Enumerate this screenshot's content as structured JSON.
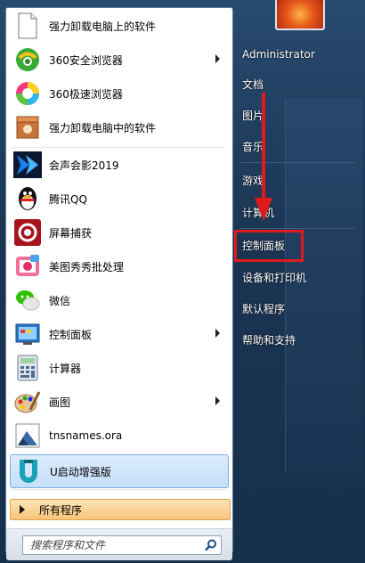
{
  "left_items": [
    {
      "label": "强力卸载电脑上的软件",
      "icon": "document-icon",
      "arrow": false
    },
    {
      "label": "360安全浏览器",
      "icon": "browser-360-icon",
      "arrow": true
    },
    {
      "label": "360极速浏览器",
      "icon": "browser-360-speed-icon",
      "arrow": false
    },
    {
      "label": "强力卸载电脑中的软件",
      "icon": "uninstall-box-icon",
      "arrow": false
    },
    {
      "label": "会声会影2019",
      "icon": "video-editor-icon",
      "arrow": false
    },
    {
      "label": "腾讯QQ",
      "icon": "qq-penguin-icon",
      "arrow": false
    },
    {
      "label": "屏幕捕获",
      "icon": "screen-capture-icon",
      "arrow": false
    },
    {
      "label": "美图秀秀批处理",
      "icon": "photo-batch-icon",
      "arrow": false
    },
    {
      "label": "微信",
      "icon": "wechat-icon",
      "arrow": false
    },
    {
      "label": "控制面板",
      "icon": "control-panel-icon",
      "arrow": true
    },
    {
      "label": "计算器",
      "icon": "calculator-icon",
      "arrow": false
    },
    {
      "label": "画图",
      "icon": "paint-icon",
      "arrow": true
    },
    {
      "label": "tnsnames.ora",
      "icon": "file-icon",
      "arrow": false
    },
    {
      "label": "U启动增强版",
      "icon": "u-boot-icon",
      "arrow": false
    }
  ],
  "all_programs_label": "所有程序",
  "search": {
    "placeholder": "搜索程序和文件"
  },
  "right_items": [
    {
      "label": "Administrator"
    },
    {
      "label": "文档"
    },
    {
      "label": "图片"
    },
    {
      "label": "音乐"
    },
    {
      "label": "游戏"
    },
    {
      "label": "计算机"
    },
    {
      "label": "控制面板"
    },
    {
      "label": "设备和打印机"
    },
    {
      "label": "默认程序"
    },
    {
      "label": "帮助和支持"
    }
  ],
  "colors": {
    "highlight_box": "#e01b1b",
    "all_programs_bg": "#f8c57a",
    "selected_item_bg": "#c4e0fb"
  }
}
